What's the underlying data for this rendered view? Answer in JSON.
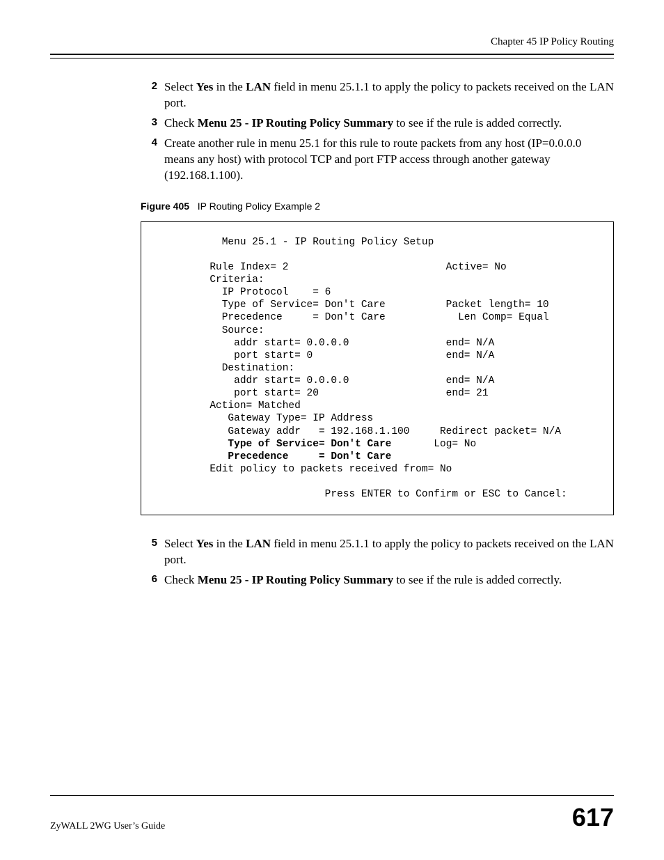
{
  "header": {
    "chapter": "Chapter 45 IP Policy Routing"
  },
  "steps1": [
    {
      "n": "2",
      "prefix": "Select ",
      "bold1": "Yes",
      "mid": " in the ",
      "bold2": "LAN",
      "suffix": " field in menu 25.1.1 to apply the policy to packets received on the LAN port."
    },
    {
      "n": "3",
      "prefix": "Check ",
      "bold1": "Menu 25 - IP Routing Policy Summary",
      "mid": "",
      "bold2": "",
      "suffix": " to see if the rule is added correctly."
    },
    {
      "n": "4",
      "prefix": "",
      "bold1": "",
      "mid": "",
      "bold2": "",
      "suffix": "Create another rule in menu 25.1 for this rule to route packets from any host (IP=0.0.0.0 means any host) with protocol TCP and port FTP access through another gateway (192.168.1.100)."
    }
  ],
  "figure": {
    "label": "Figure 405",
    "title": "IP Routing Policy Example 2"
  },
  "terminal": {
    "line_title": "           Menu 25.1 - IP Routing Policy Setup",
    "line_rule": "         Rule Index= 2                          Active= No",
    "line_criteria": "         Criteria:",
    "line_ipproto": "           IP Protocol    = 6",
    "line_tos": "           Type of Service= Don't Care          Packet length= 10",
    "line_prec": "           Precedence     = Don't Care            Len Comp= Equal",
    "line_source": "           Source:",
    "line_saddr": "             addr start= 0.0.0.0                end= N/A",
    "line_sport": "             port start= 0                      end= N/A",
    "line_dest": "           Destination:",
    "line_daddr": "             addr start= 0.0.0.0                end= N/A",
    "line_dport": "             port start= 20                     end= 21",
    "line_action": "         Action= Matched",
    "line_gwtype": "            Gateway Type= IP Address",
    "line_gwaddr": "            Gateway addr   = 192.168.1.100     Redirect packet= N/A",
    "line_btos_a": "            ",
    "line_btos_b": "Type of Service= Don't Care",
    "line_btos_c": "       Log= No",
    "line_bprec_a": "            ",
    "line_bprec_b": "Precedence     = Don't Care",
    "line_edit": "         Edit policy to packets received from= No",
    "line_press": "                            Press ENTER to Confirm or ESC to Cancel:"
  },
  "steps2": [
    {
      "n": "5",
      "prefix": "Select ",
      "bold1": "Yes",
      "mid": " in the ",
      "bold2": "LAN",
      "suffix": " field in menu 25.1.1 to apply the policy to packets received on the LAN port."
    },
    {
      "n": "6",
      "prefix": "Check ",
      "bold1": "Menu 25 - IP Routing Policy Summary",
      "mid": "",
      "bold2": "",
      "suffix": " to see if the rule is added correctly."
    }
  ],
  "footer": {
    "guide": "ZyWALL 2WG User’s Guide",
    "page": "617"
  }
}
